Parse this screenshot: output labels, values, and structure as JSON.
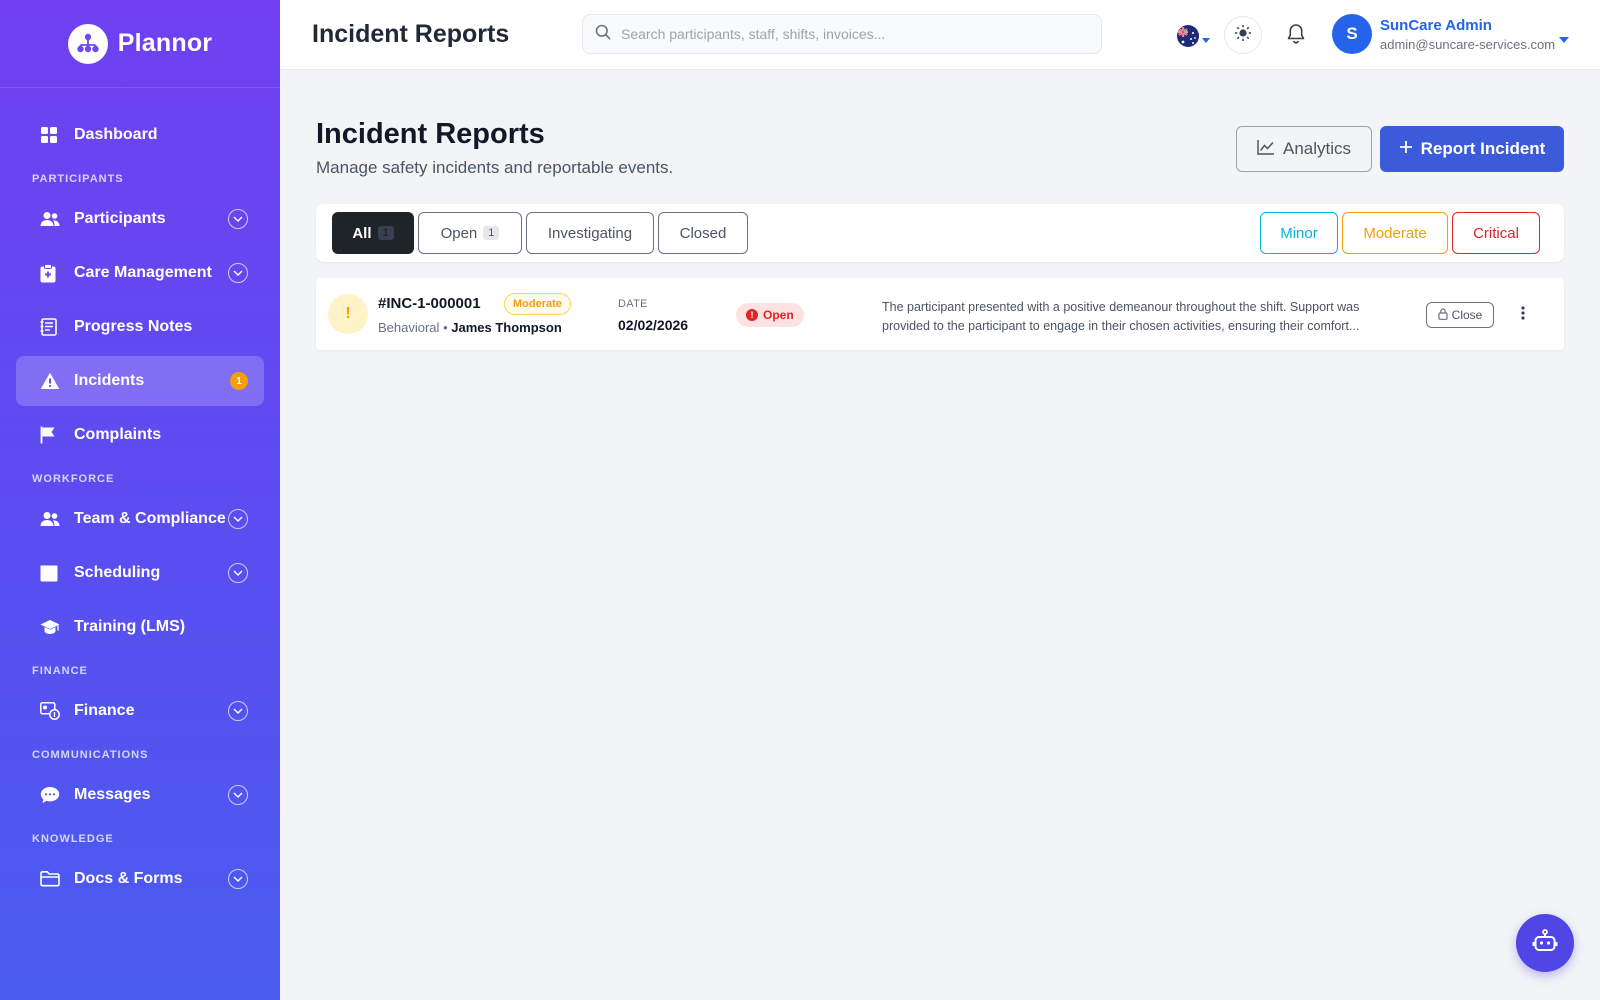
{
  "brand": {
    "name": "Plannor"
  },
  "sidebar": {
    "dashboard": "Dashboard",
    "sections": {
      "participants": "PARTICIPANTS",
      "workforce": "WORKFORCE",
      "finance": "FINANCE",
      "communications": "COMMUNICATIONS",
      "knowledge": "KNOWLEDGE"
    },
    "items": {
      "participants": "Participants",
      "care_management": "Care Management",
      "progress_notes": "Progress Notes",
      "incidents": "Incidents",
      "incidents_badge": "1",
      "complaints": "Complaints",
      "team_compliance": "Team & Compliance",
      "scheduling": "Scheduling",
      "training": "Training (LMS)",
      "finance": "Finance",
      "messages": "Messages",
      "docs_forms": "Docs & Forms"
    }
  },
  "header": {
    "title": "Incident Reports",
    "search_placeholder": "Search participants, staff, shifts, invoices...",
    "user_initial": "S",
    "user_name": "SunCare Admin",
    "user_email": "admin@suncare-services.com"
  },
  "main": {
    "title": "Incident Reports",
    "subtitle": "Manage safety incidents and reportable events.",
    "analytics_label": "Analytics",
    "report_label": "Report Incident",
    "tabs": [
      {
        "label": "All",
        "count": "1"
      },
      {
        "label": "Open",
        "count": "1"
      },
      {
        "label": "Investigating"
      },
      {
        "label": "Closed"
      }
    ],
    "severity_filters": [
      {
        "label": "Minor",
        "color": "#06b6d4"
      },
      {
        "label": "Moderate",
        "color": "#f59e0b"
      },
      {
        "label": "Critical",
        "color": "#dc2626"
      }
    ]
  },
  "incidents": [
    {
      "id": "#INC-1-000001",
      "severity": "Moderate",
      "category": "Behavioral",
      "participant": "James Thompson",
      "date_label": "DATE",
      "date": "02/02/2026",
      "status": "Open",
      "description": "The participant presented with a positive demeanour throughout the shift. Support was provided to the participant to engage in their chosen activities, ensuring their comfort...",
      "close_label": "Close"
    }
  ],
  "colors": {
    "sidebar_top": "#7040f0",
    "sidebar_bottom": "#4a5cf0",
    "primary": "#3b5bdb",
    "accent_blue": "#2563eb",
    "status_open": "#dc2626",
    "severity_moderate": "#f59e0b"
  },
  "icons": {
    "brand": "org-chart-icon",
    "search": "search-icon",
    "theme": "sun-icon",
    "notifications": "bell-icon",
    "assistant": "robot-icon"
  }
}
